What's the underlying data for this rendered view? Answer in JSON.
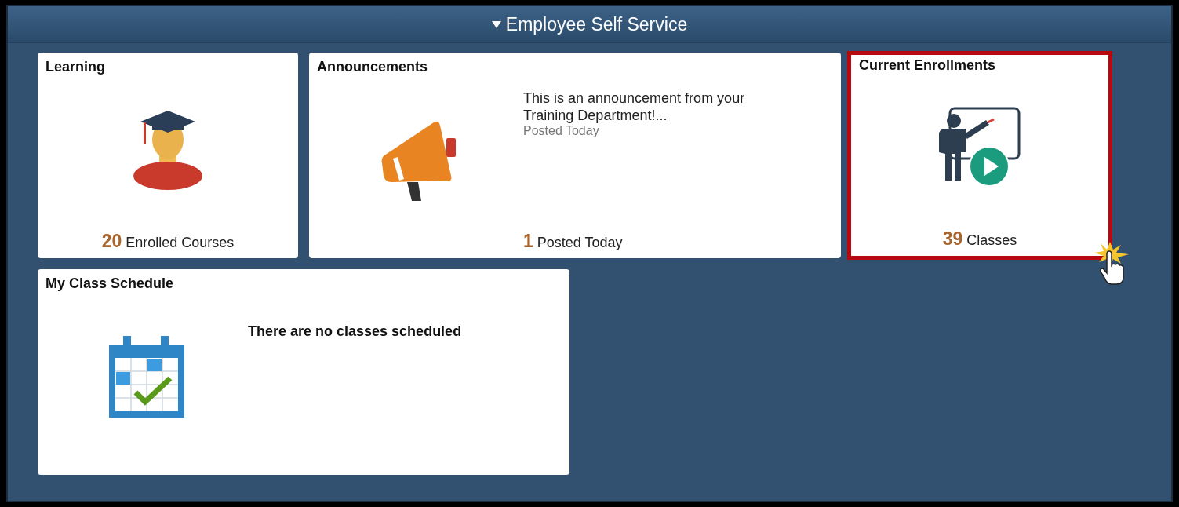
{
  "header": {
    "title": "Employee Self Service",
    "expanded": true
  },
  "tiles": [
    {
      "kind": "learning",
      "title": "Learning",
      "count": "20",
      "count_label": "Enrolled Courses",
      "highlighted": false
    },
    {
      "kind": "announcements",
      "title": "Announcements",
      "message": "This is an announcement from your Training Department!...",
      "posted": "Posted Today",
      "count": "1",
      "count_label": "Posted Today",
      "highlighted": false
    },
    {
      "kind": "enrollments",
      "title": "Current Enrollments",
      "count": "39",
      "count_label": "Classes",
      "highlighted": true
    },
    {
      "kind": "schedule",
      "title": "My Class Schedule",
      "message": "There are no classes scheduled",
      "highlighted": false
    }
  ]
}
